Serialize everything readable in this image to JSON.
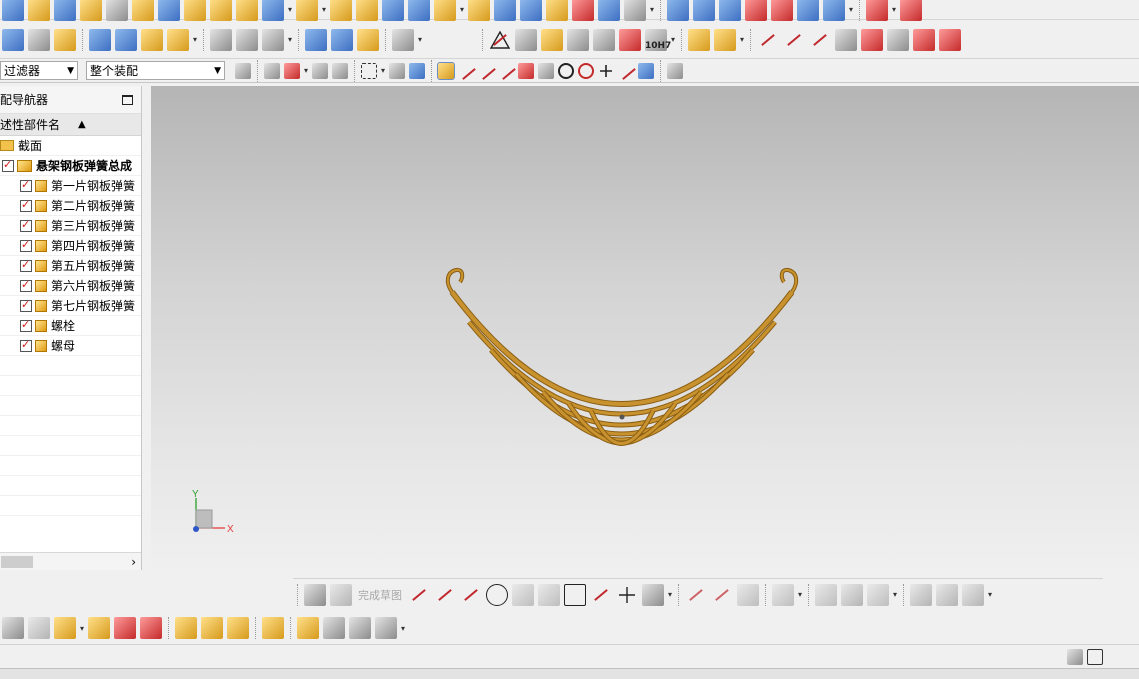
{
  "toolbar": {
    "filter_combo": "过滤器",
    "assembly_combo": "整个装配",
    "tolerance_label": "10H7"
  },
  "navigator": {
    "title": "配导航器",
    "column_header": "述性部件名",
    "sort_indicator": "▲",
    "section_label": "截面",
    "assembly": "悬架钢板弹簧总成",
    "parts": [
      "第一片钢板弹簧",
      "第二片钢板弹簧",
      "第三片钢板弹簧",
      "第四片钢板弹簧",
      "第五片钢板弹簧",
      "第六片钢板弹簧",
      "第七片钢板弹簧",
      "螺栓",
      "螺母"
    ]
  },
  "sketch_toolbar": {
    "finish_sketch": "完成草图"
  },
  "axes": {
    "x": "X",
    "y": "Y"
  },
  "colors": {
    "spring": "#c8932e",
    "spring_dark": "#8a5d12",
    "axis_x": "#e23b3b",
    "axis_y": "#2aa02a",
    "accent": "#3d6fc2"
  }
}
